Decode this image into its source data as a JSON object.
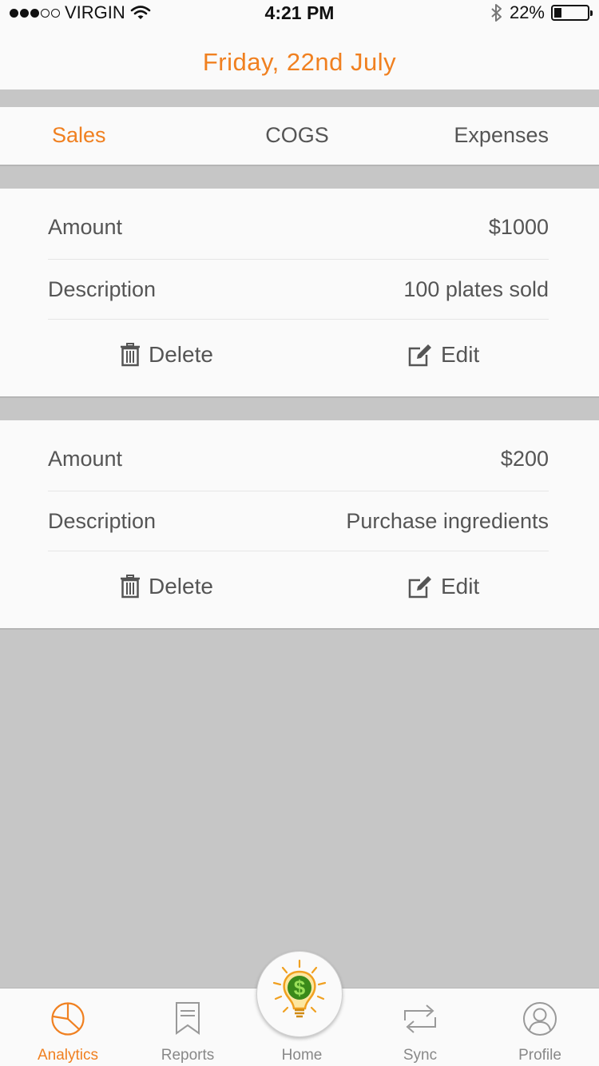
{
  "status_bar": {
    "carrier": "VIRGIN",
    "time": "4:21 PM",
    "battery": "22%",
    "battery_level": 0.22
  },
  "header": {
    "date": "Friday, 22nd July"
  },
  "tabs": [
    {
      "label": "Sales",
      "active": true
    },
    {
      "label": "COGS",
      "active": false
    },
    {
      "label": "Expenses",
      "active": false
    }
  ],
  "entries": [
    {
      "amount_label": "Amount",
      "amount": "$1000",
      "description_label": "Description",
      "description": "100 plates sold",
      "delete_label": "Delete",
      "edit_label": "Edit"
    },
    {
      "amount_label": "Amount",
      "amount": "$200",
      "description_label": "Description",
      "description": "Purchase ingredients",
      "delete_label": "Delete",
      "edit_label": "Edit"
    }
  ],
  "tabbar": {
    "items": [
      {
        "label": "Analytics",
        "icon": "pie-chart-icon",
        "active": true
      },
      {
        "label": "Reports",
        "icon": "bookmark-icon",
        "active": false
      },
      {
        "label": "Home",
        "icon": "lightbulb-dollar-icon",
        "active": false
      },
      {
        "label": "Sync",
        "icon": "sync-arrows-icon",
        "active": false
      },
      {
        "label": "Profile",
        "icon": "user-icon",
        "active": false
      }
    ]
  },
  "colors": {
    "accent": "#f08020",
    "background": "#c6c6c6",
    "surface": "#fafafa",
    "text": "#555555"
  }
}
